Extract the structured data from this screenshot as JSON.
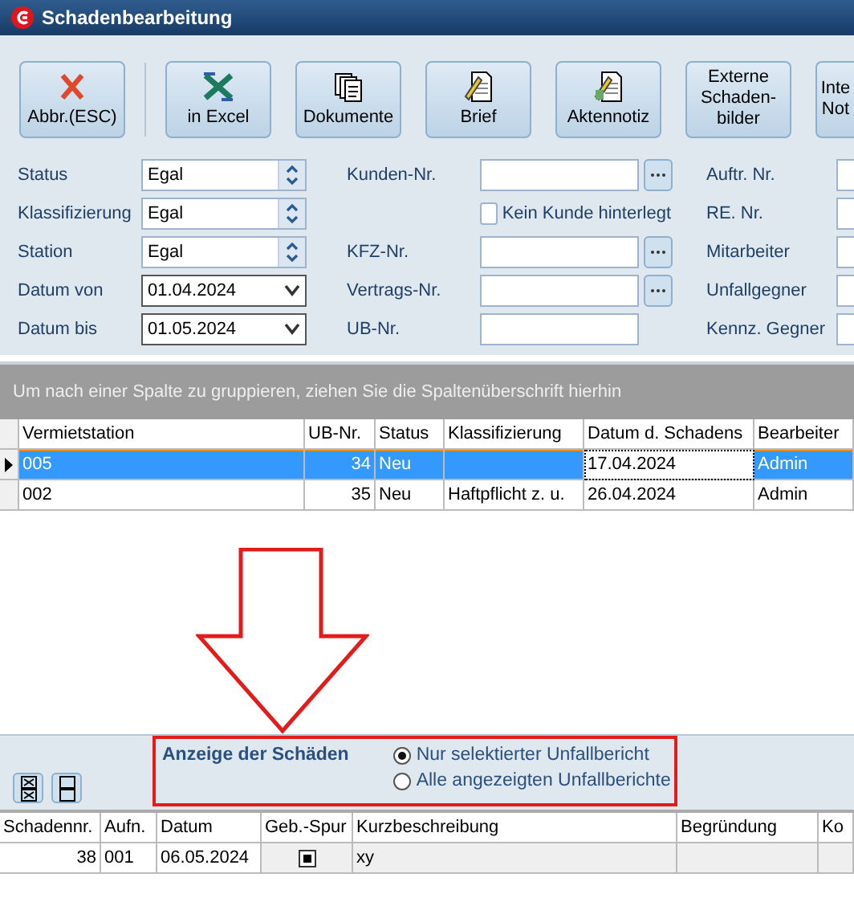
{
  "window": {
    "title": "Schadenbearbeitung"
  },
  "toolbar": [
    {
      "label": "Abbr.(ESC)",
      "kind": "cross"
    },
    {
      "label": "in Excel",
      "kind": "excel"
    },
    {
      "label": "Dokumente",
      "kind": "documents"
    },
    {
      "label": "Brief",
      "kind": "letter"
    },
    {
      "label": "Aktennotiz",
      "kind": "note"
    },
    {
      "label": "Externe\nSchaden-\nbilder",
      "kind": "text"
    },
    {
      "label": "Inte\nNot",
      "kind": "text"
    }
  ],
  "filters": [
    [
      {
        "kind": "spin",
        "label": "Status",
        "value": "Egal"
      },
      {
        "kind": "spin",
        "label": "Klassifizierung",
        "value": "Egal"
      },
      {
        "kind": "spin",
        "label": "Station",
        "value": "Egal"
      },
      {
        "kind": "date",
        "label": "Datum von",
        "value": "01.04.2024"
      },
      {
        "kind": "date",
        "label": "Datum bis",
        "value": "01.05.2024"
      }
    ],
    [
      {
        "kind": "lookup",
        "label": "Kunden-Nr."
      },
      {
        "kind": "checkbox",
        "label": "Kein Kunde hinterlegt",
        "checked": false
      },
      {
        "kind": "lookup",
        "label": "KFZ-Nr."
      },
      {
        "kind": "lookup",
        "label": "Vertrags-Nr."
      },
      {
        "kind": "text",
        "label": "UB-Nr."
      }
    ],
    [
      {
        "kind": "text",
        "label": "Auftr. Nr."
      },
      {
        "kind": "text",
        "label": "RE. Nr."
      },
      {
        "kind": "text",
        "label": "Mitarbeiter"
      },
      {
        "kind": "text",
        "label": "Unfallgegner"
      },
      {
        "kind": "text",
        "label": "Kennz. Gegner"
      }
    ]
  ],
  "grid": {
    "group_hint": "Um nach einer Spalte zu gruppieren, ziehen Sie die Spaltenüberschrift hierhin",
    "columns": [
      "Vermietstation",
      "UB-Nr.",
      "Status",
      "Klassifizierung",
      "Datum d. Schadens",
      "Bearbeiter"
    ],
    "rows": [
      {
        "selected": true,
        "cells": [
          "005",
          "34",
          "Neu",
          "",
          "17.04.2024",
          "Admin"
        ]
      },
      {
        "selected": false,
        "cells": [
          "002",
          "35",
          "Neu",
          "Haftpflicht z. u.",
          "26.04.2024",
          "Admin"
        ]
      }
    ]
  },
  "display": {
    "title": "Anzeige der Schäden",
    "options": [
      {
        "label": "Nur selektierter Unfallbericht",
        "selected": true
      },
      {
        "label": "Alle angezeigten Unfallberichte",
        "selected": false
      }
    ]
  },
  "details": {
    "columns": [
      "Schadennr.",
      "Aufn.",
      "Datum",
      "Geb.-Spur",
      "Kurzbeschreibung",
      "Begründung",
      "Ko"
    ],
    "rows": [
      {
        "schadennr": "38",
        "aufn": "001",
        "datum": "06.05.2024",
        "geb_spur": true,
        "kurzbeschreibung": "xy"
      }
    ]
  }
}
